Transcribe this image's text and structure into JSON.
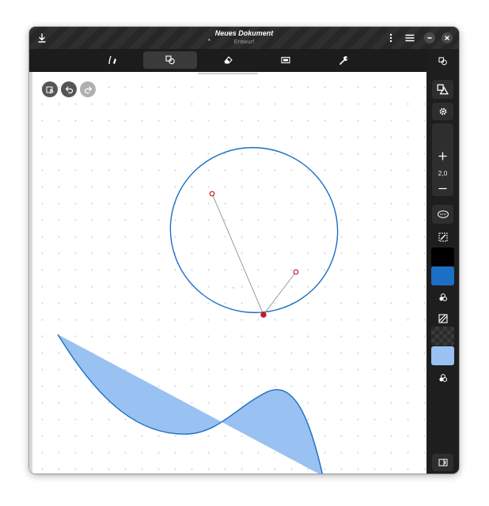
{
  "titlebar": {
    "title": "Neues Dokument",
    "subtitle": "Entwurf",
    "unsaved_marker": "•",
    "icons": [
      "download-icon",
      "kebab-menu-icon",
      "hamburger-menu-icon",
      "minimize-icon",
      "close-icon"
    ]
  },
  "toolbar": {
    "tools": [
      {
        "name": "pen",
        "icon": "pen-tool-icon",
        "active": false
      },
      {
        "name": "shapes",
        "icon": "shapes-tool-icon",
        "active": true
      },
      {
        "name": "eraser",
        "icon": "eraser-tool-icon",
        "active": false
      },
      {
        "name": "selector",
        "icon": "selector-tool-icon",
        "active": false
      },
      {
        "name": "tools",
        "icon": "wrench-tool-icon",
        "active": false
      }
    ]
  },
  "canvas_controls": {
    "icons": [
      "lock-touch-icon",
      "undo-icon",
      "redo-icon"
    ],
    "redo_enabled": false
  },
  "sidebar": {
    "stroke_width": "2,0",
    "stroke_color": "#1b6fc4",
    "fill_color": "#99c1f1",
    "icons": [
      "shapes-tool-icon",
      "settings-gear-icon",
      "plus-icon",
      "minus-icon",
      "shape-style-icon",
      "color-picker-icon",
      "palette-icon",
      "fill-toggle-icon",
      "palette-icon",
      "page-panel-icon"
    ]
  },
  "colors": {
    "accent_stroke": "#1b6fc4",
    "fill": "#99c1f1",
    "handle": "#c01c28",
    "header_bg": "#1c1c1c"
  }
}
